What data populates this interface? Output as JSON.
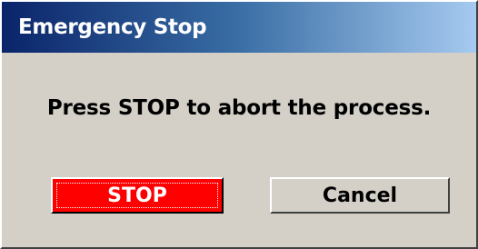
{
  "window": {
    "title": "Emergency Stop"
  },
  "dialog": {
    "message": "Press STOP to abort the process."
  },
  "buttons": {
    "stop_label": "STOP",
    "cancel_label": "Cancel"
  },
  "colors": {
    "titlebar_start": "#0a246a",
    "titlebar_end": "#a6caf0",
    "dialog_bg": "#d4d0c8",
    "stop_button": "#ff0000"
  }
}
